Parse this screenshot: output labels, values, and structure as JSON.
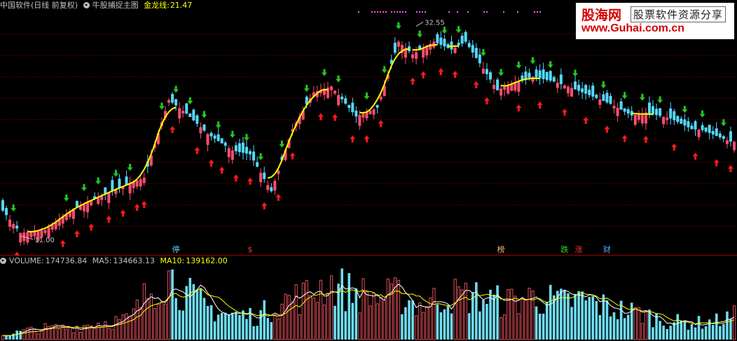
{
  "main_header": {
    "title": "中国软件(日线 前复权)",
    "indicator_name": "牛股捕捉主图",
    "dragon_label": "金龙线:",
    "dragon_value": "21.47"
  },
  "volume_header": {
    "volume_label": "VOLUME:",
    "volume_value": "174736.84",
    "ma5_label": "MA5:",
    "ma5_value": "134663.13",
    "ma10_label": "MA10:",
    "ma10_value": "139162.00"
  },
  "logo": {
    "site_name": "股海网",
    "slogan": "股票软件资源分享",
    "url": "www.Guhai.com.cn"
  },
  "colors": {
    "up": "#ff4d6d",
    "down": "#54d8ff",
    "dragon_line": "#ffff00",
    "buy_arrow": "#ff1a1a",
    "sell_arrow": "#22c522",
    "grid": "#8b0000",
    "ma5": "#ffffff",
    "ma10": "#ffff00",
    "dots": "#ff55ff",
    "header_label": "#c0c0c0",
    "dragon_text": "#ffff00",
    "ma10_text": "#ffff00"
  },
  "chart_data": [
    {
      "type": "candlestick",
      "title": "中国软件(日线 前复权)",
      "max_label": "32.55",
      "min_label": "11.00",
      "ylim": [
        10.2,
        34
      ],
      "price_points": [
        [
          0,
          13.6
        ],
        [
          5,
          11.3
        ],
        [
          12,
          11.6
        ],
        [
          20,
          13.8
        ],
        [
          27,
          15.0
        ],
        [
          34,
          16.1
        ],
        [
          40,
          17.0
        ],
        [
          47,
          25.0
        ],
        [
          52,
          23.6
        ],
        [
          58,
          21.5
        ],
        [
          65,
          19.8
        ],
        [
          70,
          19.4
        ],
        [
          76,
          15.6
        ],
        [
          82,
          22.0
        ],
        [
          88,
          25.8
        ],
        [
          93,
          26.4
        ],
        [
          100,
          23.3
        ],
        [
          106,
          24.2
        ],
        [
          112,
          31.0
        ],
        [
          116,
          29.7
        ],
        [
          122,
          31.0
        ],
        [
          127,
          30.2
        ],
        [
          131,
          31.0
        ],
        [
          140,
          26.0
        ],
        [
          144,
          26.7
        ],
        [
          150,
          27.4
        ],
        [
          156,
          26.9
        ],
        [
          162,
          26.1
        ],
        [
          172,
          24.6
        ],
        [
          178,
          23.4
        ],
        [
          182,
          23.7
        ],
        [
          189,
          23.1
        ],
        [
          195,
          22.0
        ],
        [
          198,
          21.9
        ],
        [
          206,
          20.7
        ]
      ],
      "markers": [
        {
          "text": "停",
          "color": "#54d8ff",
          "bar": 49
        },
        {
          "text": "$",
          "color": "#ff3030",
          "bar": 70
        },
        {
          "text": "榜",
          "color": "#ffb27a",
          "bar": 141
        },
        {
          "text": "跌",
          "color": "#22dd22",
          "bar": 159
        },
        {
          "text": "涨",
          "color": "#ff3030",
          "bar": 163
        },
        {
          "text": "财",
          "color": "#54a8ff",
          "bar": 171
        }
      ],
      "buy_signal_bars": [
        4,
        17,
        21,
        25,
        30,
        34,
        38,
        40,
        48,
        55,
        59,
        62,
        66,
        70,
        74,
        78,
        82,
        90,
        94,
        99,
        103,
        107,
        116,
        119,
        124,
        128,
        134,
        137,
        146,
        152,
        159,
        165,
        171,
        176,
        182,
        190,
        196,
        202,
        206
      ],
      "sell_signal_bars": [
        3,
        18,
        23,
        27,
        32,
        36,
        45,
        49,
        53,
        57,
        61,
        65,
        69,
        73,
        79,
        86,
        91,
        95,
        103,
        108,
        112,
        118,
        125,
        129,
        136,
        141,
        146,
        150,
        155,
        162,
        170,
        176,
        181,
        186,
        193,
        198,
        204
      ]
    },
    {
      "type": "bar",
      "title": "VOLUME",
      "series": [
        {
          "name": "VOLUME",
          "last": 174736.84
        },
        {
          "name": "MA5",
          "last": 134663.13
        },
        {
          "name": "MA10",
          "last": 139162.0
        }
      ],
      "volume_points": [
        [
          0,
          6
        ],
        [
          6,
          12
        ],
        [
          12,
          16
        ],
        [
          20,
          17
        ],
        [
          28,
          24
        ],
        [
          36,
          28
        ],
        [
          42,
          72
        ],
        [
          47,
          90
        ],
        [
          52,
          64
        ],
        [
          58,
          45
        ],
        [
          64,
          35
        ],
        [
          72,
          33
        ],
        [
          80,
          55
        ],
        [
          86,
          62
        ],
        [
          92,
          80
        ],
        [
          98,
          68
        ],
        [
          106,
          58
        ],
        [
          112,
          62
        ],
        [
          118,
          48
        ],
        [
          126,
          62
        ],
        [
          134,
          60
        ],
        [
          142,
          52
        ],
        [
          150,
          60
        ],
        [
          158,
          52
        ],
        [
          164,
          56
        ],
        [
          172,
          44
        ],
        [
          180,
          37
        ],
        [
          188,
          26
        ],
        [
          196,
          23
        ],
        [
          202,
          26
        ],
        [
          207,
          33
        ]
      ],
      "ylim": [
        0,
        100
      ]
    }
  ]
}
